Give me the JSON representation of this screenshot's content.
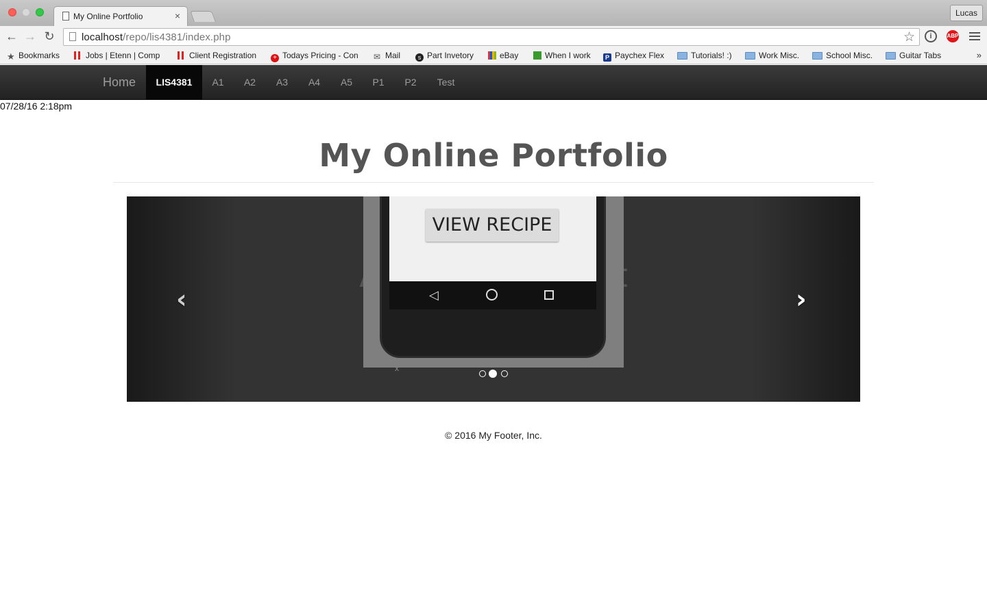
{
  "browser": {
    "tab_title": "My Online Portfolio",
    "tab_close": "×",
    "profile": "Lucas",
    "url_host": "localhost",
    "url_path": "/repo/lis4381/index.php",
    "star": "☆",
    "abp": "ABP",
    "info": "i",
    "bookmarks": [
      {
        "label": "Bookmarks",
        "icon": "star-icon"
      },
      {
        "label": "Jobs | Etenn | Comp",
        "icon": "bars-icon"
      },
      {
        "label": "Client Registration",
        "icon": "bars-icon"
      },
      {
        "label": "Todays Pricing - Con",
        "icon": "cross-icon"
      },
      {
        "label": "Mail",
        "icon": "mail-icon"
      },
      {
        "label": "Part Invetory",
        "icon": "symfony-icon"
      },
      {
        "label": "eBay",
        "icon": "ebay-icon"
      },
      {
        "label": "When I work",
        "icon": "green-icon"
      },
      {
        "label": "Paychex Flex",
        "icon": "paychex-icon"
      },
      {
        "label": "Tutorials! :)",
        "icon": "folder-icon"
      },
      {
        "label": "Work Misc.",
        "icon": "folder-icon"
      },
      {
        "label": "School Misc.",
        "icon": "folder-icon"
      },
      {
        "label": "Guitar Tabs",
        "icon": "folder-icon"
      }
    ],
    "more": "»"
  },
  "nav": {
    "brand": "Home",
    "items": [
      "LIS4381",
      "A1",
      "A2",
      "A3",
      "A4",
      "A5",
      "P1",
      "P2",
      "Test"
    ],
    "active_item": "LIS4381"
  },
  "timestamp": "07/28/16 2:18pm",
  "page": {
    "title": "My Online Portfolio"
  },
  "carousel": {
    "caption_fragment_left": "A",
    "caption_fragment_right": "t",
    "button_label": "VIEW RECIPE",
    "prev_glyph": "‹",
    "next_glyph": "›",
    "glitch_mark": "x",
    "slide_count": 3,
    "active_slide": 2
  },
  "footer": "© 2016 My Footer, Inc.",
  "colors": {
    "navbar": "#222222",
    "active_nav": "#080808",
    "title": "#555555",
    "carousel_bg": "#333333"
  }
}
